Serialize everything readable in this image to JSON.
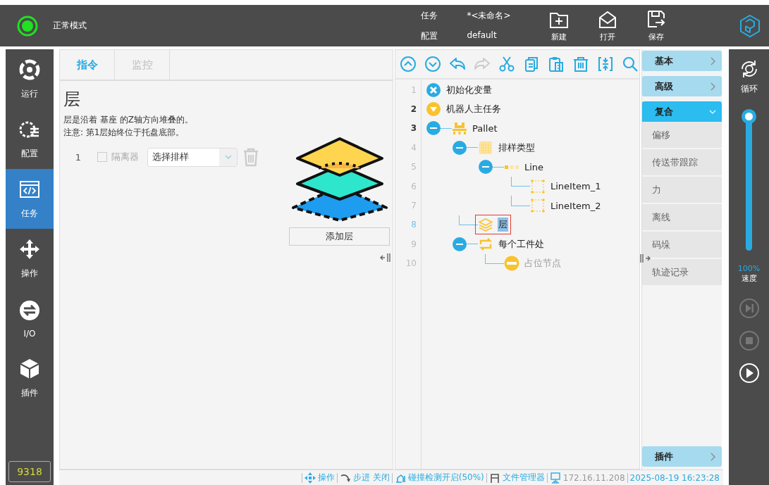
{
  "header": {
    "status": {
      "on": true
    },
    "mode": "正常模式",
    "task_label": "任务",
    "task_value": "*<未命名>",
    "config_label": "配置",
    "config_value": "default",
    "actions": [
      {
        "kind": "new",
        "label": "新建"
      },
      {
        "kind": "open",
        "label": "打开"
      },
      {
        "kind": "save",
        "label": "保存"
      }
    ]
  },
  "nav": {
    "items": [
      {
        "kind": "run",
        "label": "运行",
        "selected": false
      },
      {
        "kind": "config",
        "label": "配置",
        "selected": false
      },
      {
        "kind": "task",
        "label": "任务",
        "selected": true
      },
      {
        "kind": "operate",
        "label": "操作",
        "selected": false
      },
      {
        "kind": "io",
        "label": "I/O",
        "selected": false
      },
      {
        "kind": "plugin",
        "label": "插件",
        "selected": false
      }
    ],
    "counter": "9318"
  },
  "instruction_panel": {
    "tabs": [
      {
        "label": "指令",
        "selected": true
      },
      {
        "label": "监控",
        "selected": false
      }
    ],
    "title": "层",
    "description": [
      "层是沿着 基座 的Z轴方向堆叠的。",
      "注意: 第1层始终位于托盘底部。"
    ],
    "layers": [
      {
        "index": "1",
        "separator": {
          "label": "隔离器",
          "checked": false,
          "disabled": true
        },
        "pattern": "选择排样",
        "delete_disabled": true
      }
    ],
    "add_button": "添加层"
  },
  "tree": {
    "toolbar": [
      {
        "kind": "up",
        "disabled": false
      },
      {
        "kind": "down",
        "disabled": false
      },
      {
        "kind": "undo",
        "disabled": false
      },
      {
        "kind": "redo",
        "disabled": true
      },
      {
        "kind": "cut",
        "disabled": false
      },
      {
        "kind": "copy",
        "disabled": false
      },
      {
        "kind": "paste",
        "disabled": false
      },
      {
        "kind": "delete",
        "disabled": false
      },
      {
        "kind": "fold",
        "disabled": false
      },
      {
        "kind": "search",
        "disabled": false
      }
    ],
    "nodes": [
      {
        "line": "1",
        "label": "初始化变量",
        "kind": "init",
        "active": false,
        "selected": false
      },
      {
        "line": "2",
        "label": "机器人主任务",
        "kind": "main",
        "active": true,
        "selected": false,
        "children": [
          {
            "line": "3",
            "label": "Pallet",
            "kind": "pallet",
            "active": true,
            "selected": false,
            "expanded": true,
            "children": [
              {
                "line": "4",
                "label": "排样类型",
                "kind": "pattern",
                "active": false,
                "selected": false,
                "expanded": true,
                "children": [
                  {
                    "line": "5",
                    "label": "Line",
                    "kind": "line",
                    "active": false,
                    "selected": false,
                    "expanded": true,
                    "children": [
                      {
                        "line": "6",
                        "label": "LineItem_1",
                        "kind": "line-item",
                        "active": false,
                        "selected": false
                      },
                      {
                        "line": "7",
                        "label": "LineItem_2",
                        "kind": "line-item",
                        "active": false,
                        "selected": false
                      }
                    ]
                  }
                ]
              },
              {
                "line": "8",
                "label": "层",
                "kind": "layer",
                "active": false,
                "selected": true
              },
              {
                "line": "9",
                "label": "每个工件处",
                "kind": "loop",
                "active": false,
                "selected": false,
                "expanded": true,
                "children": [
                  {
                    "line": "10",
                    "label": "占位节点",
                    "kind": "placeholder",
                    "active": false,
                    "selected": false
                  }
                ]
              }
            ]
          }
        ]
      }
    ]
  },
  "palette": {
    "categories": [
      {
        "label": "基本",
        "expanded": false
      },
      {
        "label": "高级",
        "expanded": false
      },
      {
        "label": "复合",
        "expanded": true,
        "items": [
          "偏移",
          "传送带跟踪",
          "力",
          "离线",
          "码垛",
          "轨迹记录"
        ]
      }
    ],
    "plugin": {
      "label": "插件",
      "expanded": false
    }
  },
  "run_bar": {
    "loop_label": "循环",
    "speed": {
      "level": 1,
      "reading": "100%",
      "label": "速度"
    },
    "controls": [
      {
        "kind": "step",
        "disabled": true
      },
      {
        "kind": "stop",
        "disabled": true
      },
      {
        "kind": "play",
        "disabled": false
      }
    ]
  },
  "status_bar": {
    "items": [
      {
        "kind": "operate",
        "label": "操作"
      },
      {
        "kind": "step",
        "label": "步进 关闭"
      },
      {
        "kind": "collision",
        "label": "碰撞检测开启(50%)"
      },
      {
        "kind": "files",
        "label": "文件管理器"
      },
      {
        "kind": "ip",
        "label": "172.16.11.208"
      },
      {
        "kind": "time",
        "label": "2025-08-19 16:23:28"
      }
    ]
  }
}
